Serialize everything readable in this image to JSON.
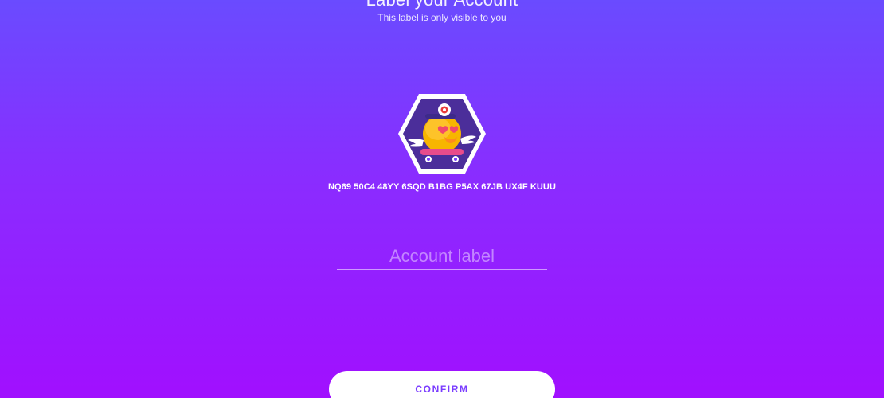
{
  "header": {
    "title": "Label your Account",
    "subtitle": "This label is only visible to you"
  },
  "account": {
    "avatar_icon": "robot-duck-skateboard-avatar-icon",
    "id": "NQ69 50C4 48YY 6SQD B1BG P5AX 67JB UX4F KUUU"
  },
  "label_input": {
    "value": "",
    "placeholder": "Account label"
  },
  "actions": {
    "confirm_label": "CONFIRM"
  },
  "colors": {
    "gradient_top": "#6a4bff",
    "gradient_bottom": "#a10fff",
    "button_text": "#7a3cff",
    "avatar_bg": "#4b2e9a",
    "avatar_body": "#f7b500"
  }
}
